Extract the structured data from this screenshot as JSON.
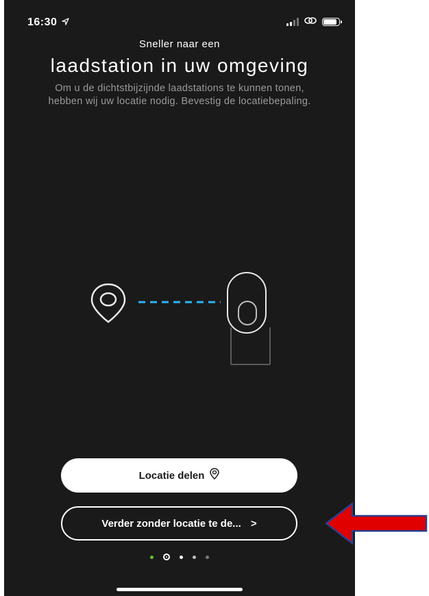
{
  "status_bar": {
    "time": "16:30"
  },
  "onboarding": {
    "subtitle": "Sneller naar een",
    "title": "laadstation in uw omgeving",
    "description_line1": "Om u de dichtstbijzijnde laadstations te kunnen tonen,",
    "description_line2": "hebben wij uw locatie nodig. Bevestig de locatiebepaling."
  },
  "buttons": {
    "share_location_label": "Locatie delen",
    "skip_label": "Verder zonder locatie te de...",
    "skip_chevron": ">"
  },
  "pagination": {
    "total": 5,
    "active_index": 1
  },
  "colors": {
    "background": "#1a1a1a",
    "accent_dashes": "#29b6f6",
    "dot_green": "#6abf2e",
    "annotation_arrow": "#e00000",
    "annotation_arrow_outline": "#2b3f8f"
  },
  "icons": {
    "location": "location-pin-icon",
    "charger": "charging-station-icon",
    "annotation": "red-arrow-annotation"
  }
}
